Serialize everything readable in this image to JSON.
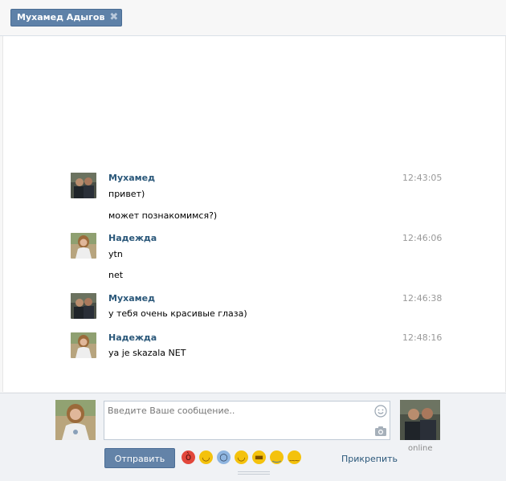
{
  "tab": {
    "label": "Мухамед Адыгов",
    "close": "✖"
  },
  "messages": [
    {
      "author": "Мухамед",
      "time": "12:43:05",
      "avatar": "avatar-muhamed-icon",
      "lines": [
        "привет)",
        "может познакомимся?)"
      ]
    },
    {
      "author": "Надежда",
      "time": "12:46:06",
      "avatar": "avatar-nadezhda-icon",
      "lines": [
        "ytn",
        "net"
      ]
    },
    {
      "author": "Мухамед",
      "time": "12:46:38",
      "avatar": "avatar-muhamed-icon",
      "lines": [
        "у тебя очень красивые глаза)"
      ]
    },
    {
      "author": "Надежда",
      "time": "12:48:16",
      "avatar": "avatar-nadezhda-icon",
      "lines": [
        "ya je skazala NET"
      ]
    }
  ],
  "composer": {
    "placeholder": "Введите Ваше сообщение..",
    "send_label": "Отправить",
    "attach_label": "Прикрепить",
    "status": "online",
    "emojis": [
      "angry-emoji-icon",
      "blush-emoji-icon",
      "scream-emoji-icon",
      "grin-emoji-icon",
      "laugh-emoji-icon",
      "cry-emoji-icon",
      "tired-emoji-icon"
    ]
  },
  "colors": {
    "accent": "#5e81a8",
    "link": "#2b587a",
    "time": "#999999",
    "emoji": "#f4c20d"
  }
}
